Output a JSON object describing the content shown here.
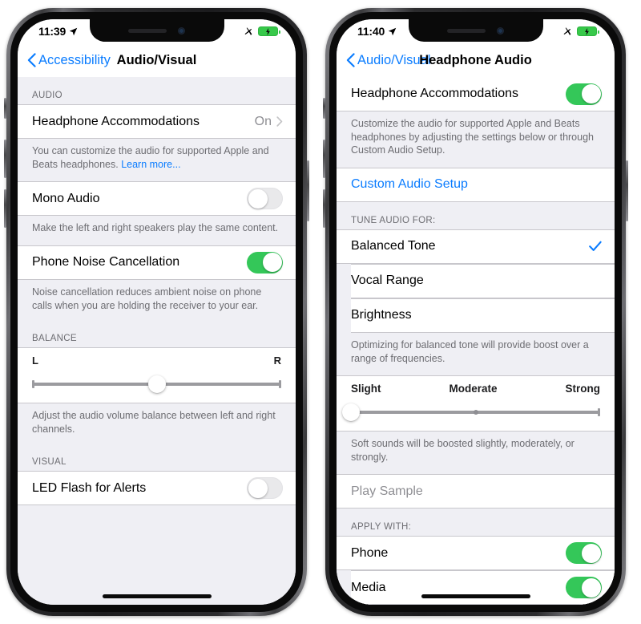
{
  "phones": [
    {
      "id": "left",
      "statusbar": {
        "time": "11:39",
        "location_icon": "location-arrow-icon",
        "airplane_icon": "airplane-mode-icon",
        "battery_icon": "battery-charging-icon"
      },
      "navbar": {
        "back_label": "Accessibility",
        "title": "Audio/Visual",
        "back_icon": "chevron-left-icon"
      },
      "sections": [
        {
          "header": "AUDIO",
          "rows": [
            {
              "label": "Headphone Accommodations",
              "value": "On",
              "accessory": "chevron-right-icon"
            }
          ],
          "footnote": "You can customize the audio for supported Apple and Beats headphones. ",
          "footnote_link": "Learn more..."
        },
        {
          "rows": [
            {
              "label": "Mono Audio",
              "toggle": "off"
            }
          ],
          "footnote": "Make the left and right speakers play the same content."
        },
        {
          "rows": [
            {
              "label": "Phone Noise Cancellation",
              "toggle": "on"
            }
          ],
          "footnote": "Noise cancellation reduces ambient noise on phone calls when you are holding the receiver to your ear."
        },
        {
          "header": "BALANCE",
          "slider": {
            "left_label": "L",
            "right_label": "R",
            "thumb_percent": 50
          },
          "footnote": "Adjust the audio volume balance between left and right channels."
        },
        {
          "header": "VISUAL",
          "rows": [
            {
              "label": "LED Flash for Alerts",
              "toggle": "off"
            }
          ]
        }
      ]
    },
    {
      "id": "right",
      "statusbar": {
        "time": "11:40",
        "location_icon": "location-arrow-icon",
        "airplane_icon": "airplane-mode-icon",
        "battery_icon": "battery-charging-icon"
      },
      "navbar": {
        "back_label": "Audio/Visual",
        "title": "Headphone Audio",
        "back_icon": "chevron-left-icon"
      },
      "sections": [
        {
          "rows": [
            {
              "label": "Headphone Accommodations",
              "toggle": "on"
            }
          ],
          "footnote": "Customize the audio for supported Apple and Beats headphones by adjusting the settings below or through Custom Audio Setup."
        },
        {
          "rows": [
            {
              "label": "Custom Audio Setup",
              "style": "blue"
            }
          ]
        },
        {
          "header": "TUNE AUDIO FOR:",
          "rows": [
            {
              "label": "Balanced Tone",
              "accessory": "checkmark-icon"
            },
            {
              "label": "Vocal Range"
            },
            {
              "label": "Brightness"
            }
          ],
          "footnote": "Optimizing for balanced tone will provide boost over a range of frequencies."
        },
        {
          "slider": {
            "left_label": "Slight",
            "mid_label": "Moderate",
            "right_label": "Strong",
            "thumb_percent": 0,
            "tick_percent": 50
          },
          "footnote": "Soft sounds will be boosted slightly, moderately, or strongly."
        },
        {
          "rows": [
            {
              "label": "Play Sample",
              "style": "muted"
            }
          ]
        },
        {
          "header": "APPLY WITH:",
          "rows": [
            {
              "label": "Phone",
              "toggle": "on"
            },
            {
              "label": "Media",
              "toggle": "on"
            }
          ]
        }
      ]
    }
  ],
  "colors": {
    "accent_blue": "#0a7cff",
    "toggle_on_green": "#34c759",
    "group_background": "#efeff4",
    "row_background": "#ffffff",
    "secondary_text": "#6d6d72"
  }
}
